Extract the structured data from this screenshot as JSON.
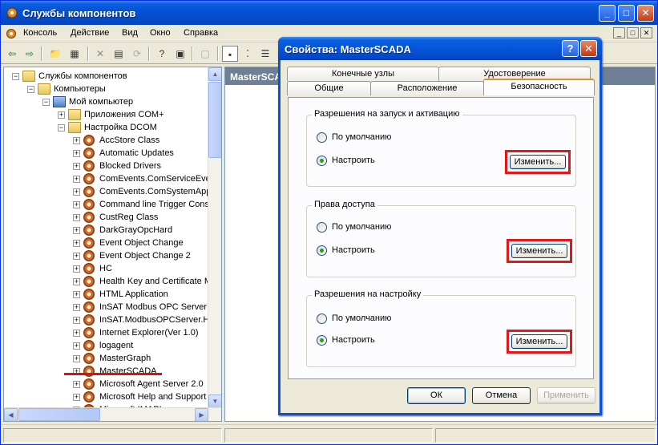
{
  "window": {
    "title": "Службы компонентов",
    "controls": [
      "_",
      "□",
      "✕"
    ]
  },
  "menu": {
    "items": [
      "Консоль",
      "Действие",
      "Вид",
      "Окно",
      "Справка"
    ],
    "mdi_controls": [
      "_",
      "□",
      "✕"
    ]
  },
  "tree": {
    "items": [
      {
        "label": "Службы компонентов",
        "level": 0,
        "expander": "−",
        "icon": "folder"
      },
      {
        "label": "Компьютеры",
        "level": 1,
        "expander": "−",
        "icon": "folder"
      },
      {
        "label": "Мой компьютер",
        "level": 2,
        "expander": "−",
        "icon": "computer"
      },
      {
        "label": "Приложения COM+",
        "level": 3,
        "expander": "+",
        "icon": "folder"
      },
      {
        "label": "Настройка DCOM",
        "level": 3,
        "expander": "−",
        "icon": "folder"
      },
      {
        "label": "AccStore Class",
        "level": 4,
        "expander": "+",
        "icon": "gear"
      },
      {
        "label": "Automatic Updates",
        "level": 4,
        "expander": "+",
        "icon": "gear"
      },
      {
        "label": "Blocked Drivers",
        "level": 4,
        "expander": "+",
        "icon": "gear"
      },
      {
        "label": "ComEvents.ComServiceEver",
        "level": 4,
        "expander": "+",
        "icon": "gear"
      },
      {
        "label": "ComEvents.ComSystemApp",
        "level": 4,
        "expander": "+",
        "icon": "gear"
      },
      {
        "label": "Command line Trigger Consu",
        "level": 4,
        "expander": "+",
        "icon": "gear"
      },
      {
        "label": "CustReg Class",
        "level": 4,
        "expander": "+",
        "icon": "gear"
      },
      {
        "label": "DarkGrayOpcHard",
        "level": 4,
        "expander": "+",
        "icon": "gear"
      },
      {
        "label": "Event Object Change",
        "level": 4,
        "expander": "+",
        "icon": "gear"
      },
      {
        "label": "Event Object Change 2",
        "level": 4,
        "expander": "+",
        "icon": "gear"
      },
      {
        "label": "HC",
        "level": 4,
        "expander": "+",
        "icon": "gear"
      },
      {
        "label": "Health Key and Certificate M",
        "level": 4,
        "expander": "+",
        "icon": "gear"
      },
      {
        "label": "HTML Application",
        "level": 4,
        "expander": "+",
        "icon": "gear"
      },
      {
        "label": "InSAT Modbus OPC Server D",
        "level": 4,
        "expander": "+",
        "icon": "gear"
      },
      {
        "label": "InSAT.ModbusOPCServer.H",
        "level": 4,
        "expander": "+",
        "icon": "gear"
      },
      {
        "label": "Internet Explorer(Ver 1.0)",
        "level": 4,
        "expander": "+",
        "icon": "gear"
      },
      {
        "label": "logagent",
        "level": 4,
        "expander": "+",
        "icon": "gear"
      },
      {
        "label": "MasterGraph",
        "level": 4,
        "expander": "+",
        "icon": "gear"
      },
      {
        "label": "MasterSCADA",
        "level": 4,
        "expander": "+",
        "icon": "gear"
      },
      {
        "label": "Microsoft Agent Server 2.0",
        "level": 4,
        "expander": "+",
        "icon": "gear"
      },
      {
        "label": "Microsoft Help and Support",
        "level": 4,
        "expander": "+",
        "icon": "gear"
      },
      {
        "label": "Microsoft IMAPI",
        "level": 4,
        "expander": "+",
        "icon": "gear"
      }
    ]
  },
  "list_pane": {
    "header": "MasterSCA"
  },
  "dialog": {
    "title": "Свойства: MasterSCADA",
    "help_label": "?",
    "close_label": "✕",
    "tabs_back": [
      "Конечные узлы",
      "Удостоверение"
    ],
    "tabs_front": [
      "Общие",
      "Расположение",
      "Безопасность"
    ],
    "active_tab": "Безопасность",
    "groups": [
      {
        "title": "Разрешения на запуск и активацию",
        "option_default": "По умолчанию",
        "option_custom": "Настроить",
        "selected": "custom",
        "edit_label": "Изменить..."
      },
      {
        "title": "Права доступа",
        "option_default": "По умолчанию",
        "option_custom": "Настроить",
        "selected": "custom",
        "edit_label": "Изменить..."
      },
      {
        "title": "Разрешения на настройку",
        "option_default": "По умолчанию",
        "option_custom": "Настроить",
        "selected": "custom",
        "edit_label": "Изменить..."
      }
    ],
    "buttons": {
      "ok": "ОК",
      "cancel": "Отмена",
      "apply": "Применить"
    }
  },
  "colors": {
    "highlight": "#e01a1a",
    "title_blue": "#0a5fe0",
    "tab_accent": "#e68b2c"
  }
}
